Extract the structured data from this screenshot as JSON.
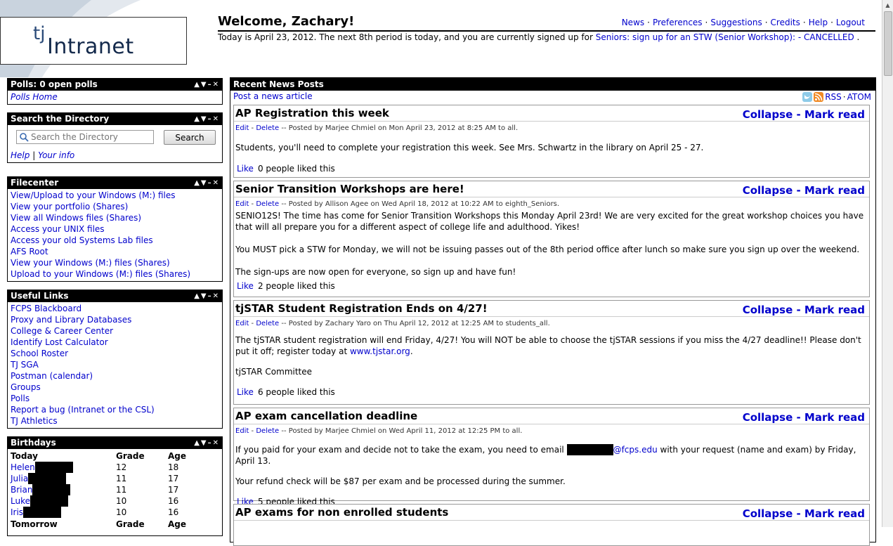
{
  "logo": {
    "tj": "tj",
    "intranet": "Intranet"
  },
  "header": {
    "welcome": "Welcome, Zachary!",
    "status_prefix": "Today is April 23, 2012. The next 8th period is today, and you are currently signed up for ",
    "status_link": "Seniors: sign up for an STW (Senior Workshop): - CANCELLED",
    "status_suffix": " .",
    "nav": [
      "News",
      "Preferences",
      "Suggestions",
      "Credits",
      "Help",
      "Logout"
    ],
    "nav_sep": "·"
  },
  "box_controls": "▲▼–✕",
  "polls": {
    "title": "Polls: 0 open polls",
    "link": "Polls Home"
  },
  "directory": {
    "title": "Search the Directory",
    "placeholder": "Search the Directory",
    "button": "Search",
    "help": "Help",
    "sep": "|",
    "your_info": "Your info"
  },
  "filecenter": {
    "title": "Filecenter",
    "links": [
      "View/Upload to your Windows (M:) files",
      "View your portfolio (Shares)",
      "View all Windows files (Shares)",
      "Access your UNIX files",
      "Access your old Systems Lab files",
      "AFS Root",
      "View your Windows (M:) files (Shares)",
      "Upload to your Windows (M:) files (Shares)"
    ]
  },
  "useful_links": {
    "title": "Useful Links",
    "links": [
      "FCPS Blackboard",
      "Proxy and Library Databases",
      "College & Career Center",
      "Identify Lost Calculator",
      "School Roster",
      "TJ SGA",
      "Postman (calendar)",
      "Groups",
      "Polls",
      "Report a bug (Intranet or the CSL)",
      "TJ Athletics"
    ]
  },
  "birthdays": {
    "title": "Birthdays",
    "today_header": [
      "Today",
      "Grade",
      "Age"
    ],
    "today": [
      {
        "name": "Helen",
        "grade": "12",
        "age": "18"
      },
      {
        "name": "Julia",
        "grade": "11",
        "age": "17"
      },
      {
        "name": "Brian",
        "grade": "11",
        "age": "17"
      },
      {
        "name": "Luke",
        "grade": "10",
        "age": "16"
      },
      {
        "name": "Iris",
        "grade": "10",
        "age": "16"
      }
    ],
    "tomorrow_header": [
      "Tomorrow",
      "Grade",
      "Age"
    ]
  },
  "news": {
    "title": "Recent News Posts",
    "post_link": "Post a news article",
    "rss": "RSS",
    "rss_sep": "·",
    "atom": "ATOM",
    "collapse": "Collapse",
    "dash": " - ",
    "mark_read": "Mark read",
    "edit": "Edit",
    "delete": "Delete",
    "like": "Like",
    "posts": [
      {
        "title": "AP Registration this week",
        "meta": " -- Posted by Marjee Chmiel on Mon April 23, 2012 at 8:25 AM to all.",
        "body": [
          "Students, you'll need to complete your registration this week. See Mrs. Schwartz in the library on April 25 - 27."
        ],
        "likes": "0 people liked this"
      },
      {
        "title": "Senior Transition Workshops are here!",
        "meta": " -- Posted by Allison Agee on Wed April 18, 2012 at 10:22 AM to eighth_Seniors.",
        "body": [
          "SENIO12S!  The time has come for Senior Transition Workshops this Monday April 23rd!  We are very excited for the great workshop choices you have that will all prepare you for a different aspect of college life and adulthood.  Yikes!",
          "You MUST pick a STW for Monday, we will not be issuing passes out of the 8th period office after lunch so make sure you sign up over the weekend.",
          "The sign-ups are now open for everyone, so sign up and have fun!"
        ],
        "likes": "2 people liked this"
      },
      {
        "title": "tjSTAR Student Registration Ends on 4/27!",
        "meta": " -- Posted by Zachary Yaro on Thu April 12, 2012 at 12:25 AM to students_all.",
        "body_prefix": "The tjSTAR student registration will end Friday, 4/27!  You will NOT be able to choose the tjSTAR sessions if you miss the 4/27 deadline!!  Please don't put it off; register today at ",
        "body_link": "www.tjstar.org",
        "body_suffix": ".",
        "body2": "tjSTAR Committee",
        "likes": "6 people liked this"
      },
      {
        "title": "AP exam cancellation deadline",
        "meta": " -- Posted by Marjee Chmiel on Wed April 11, 2012 at 12:25 PM to all.",
        "body_prefix": "If you paid for your exam and decide not to take the exam, you need to email ",
        "body_link": "@fcps.edu",
        "body_suffix": " with your request (name and exam) by Friday, April 13.",
        "body2": "Your refund check will be $87 per exam and be processed during the summer.",
        "likes": "5 people liked this"
      },
      {
        "title": "AP exams for non enrolled students"
      }
    ]
  }
}
